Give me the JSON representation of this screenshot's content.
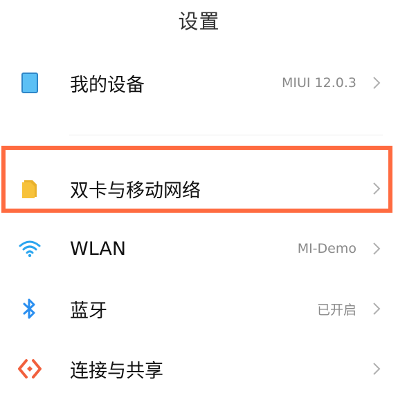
{
  "header": {
    "title": "设置"
  },
  "items": [
    {
      "label": "我的设备",
      "value": "MIUI 12.0.3",
      "icon": "device-icon"
    },
    {
      "label": "双卡与移动网络",
      "value": "",
      "icon": "sim-card-icon"
    },
    {
      "label": "WLAN",
      "value": "MI-Demo",
      "icon": "wifi-icon"
    },
    {
      "label": "蓝牙",
      "value": "已开启",
      "icon": "bluetooth-icon"
    },
    {
      "label": "连接与共享",
      "value": "",
      "icon": "connection-share-icon"
    }
  ],
  "colors": {
    "highlight": "#ff6b40",
    "device_icon": "#48b3f0",
    "sim_icon": "#f7c23b",
    "wifi_icon": "#2aa5ef",
    "bluetooth_icon": "#2a8ff0",
    "share_icon": "#f1603d"
  }
}
